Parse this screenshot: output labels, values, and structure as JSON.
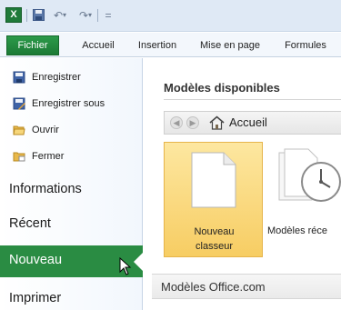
{
  "qat": {
    "app_icon_letter": "X",
    "customize_glyph": "=",
    "accent": "#1f7a3a"
  },
  "tabs": {
    "file": "Fichier",
    "items": [
      "Accueil",
      "Insertion",
      "Mise en page",
      "Formules"
    ]
  },
  "nav": {
    "commands": [
      "Enregistrer",
      "Enregistrer sous",
      "Ouvrir",
      "Fermer"
    ],
    "sections": [
      "Informations",
      "Récent"
    ],
    "selected": "Nouveau",
    "after": [
      "Imprimer"
    ],
    "selected_color": "#2a8c43"
  },
  "main": {
    "heading": "Modèles disponibles",
    "breadcrumb": "Accueil",
    "tiles": [
      {
        "label_line1": "Nouveau",
        "label_line2": "classeur"
      },
      {
        "label_line1": "Modèles réce"
      }
    ],
    "office_section": "Modèles Office.com"
  }
}
